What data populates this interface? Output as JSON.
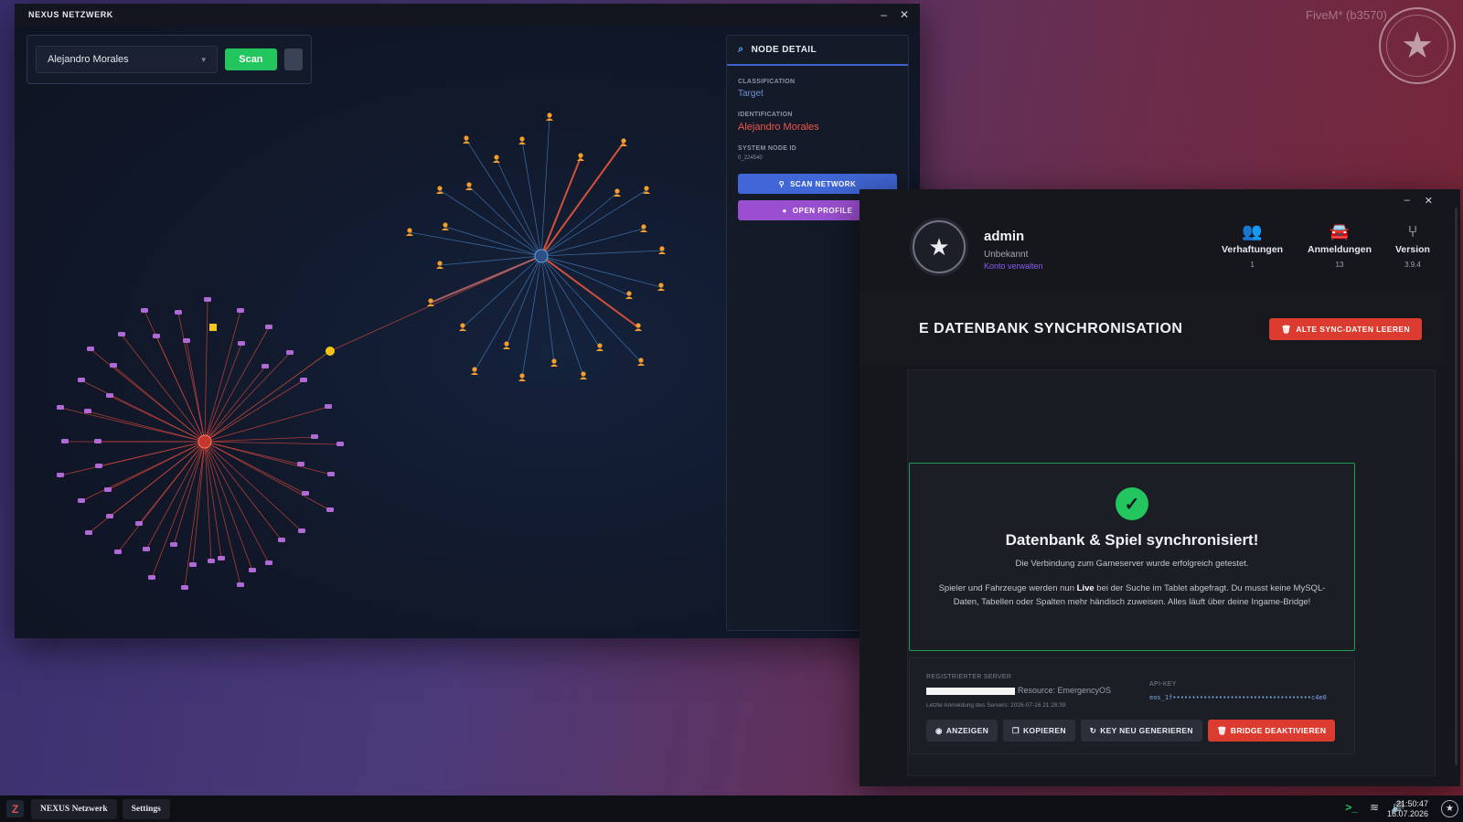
{
  "desktop": {
    "label": "FiveM* (b3570)"
  },
  "nexus": {
    "title": "NEXUS NETZWERK",
    "minimize": "–",
    "close": "✕",
    "search": {
      "selected": "Alejandro Morales",
      "scan_label": "Scan"
    },
    "panel": {
      "title": "NODE DETAIL",
      "classification_label": "CLASSIFICATION",
      "classification_value": "Target",
      "identification_label": "IDENTIFICATION",
      "identification_value": "Alejandro Morales",
      "node_id_label": "SYSTEM NODE ID",
      "node_id_value": "0_224540",
      "scan_network": "SCAN NETWORK",
      "open_profile": "OPEN PROFILE"
    }
  },
  "sync": {
    "minimize": "–",
    "close": "✕",
    "profile": {
      "name": "admin",
      "subtitle": "Unbekannt",
      "manage_link": "Konto verwalten"
    },
    "stats": [
      {
        "icon": "users-icon",
        "label": "Verhaftungen",
        "value": "1"
      },
      {
        "icon": "car-icon",
        "label": "Anmeldungen",
        "value": "13"
      },
      {
        "icon": "git-branch-icon",
        "label": "Version",
        "value": "3.9.4"
      }
    ],
    "header_title": "E DATENBANK SYNCHRONISATION",
    "clear_button": "ALTE SYNC-DATEN LEEREN",
    "success": {
      "title": "Datenbank & Spiel synchronisiert!",
      "text1": "Die Verbindung zum Gameserver wurde erfolgreich getestet.",
      "text2_a": "Spieler und Fahrzeuge werden nun ",
      "text2_b": "Live",
      "text2_c": " bei der Suche im Tablet abgefragt. Du musst keine MySQL-Daten, Tabellen oder Spalten mehr händisch zuweisen. Alles läuft über deine Ingame-Bridge!"
    },
    "server": {
      "registered_label": "REGISTRIERTER SERVER",
      "resource": "Resource: EmergencyOS",
      "last_login": "Letzte Anmeldung des Servers: 2026-07-16 21:28:39",
      "api_label": "API-KEY",
      "api_key": "eos_1f••••••••••••••••••••••••••••••••••••c4e0",
      "buttons": {
        "show": "ANZEIGEN",
        "copy": "KOPIEREN",
        "regenerate": "KEY NEU GENERIEREN",
        "deactivate": "BRIDGE DEAKTIVIEREN"
      }
    }
  },
  "taskbar": {
    "apps": [
      "NEXUS Netzwerk",
      "Settings"
    ],
    "time": "21:50:47",
    "date": "16.07.2026"
  },
  "colors": {
    "accent_green": "#22c55e",
    "accent_blue": "#4166d5",
    "accent_purple": "#9a4fd0",
    "danger": "#dc3b2f",
    "link_red": "#f0554a"
  }
}
